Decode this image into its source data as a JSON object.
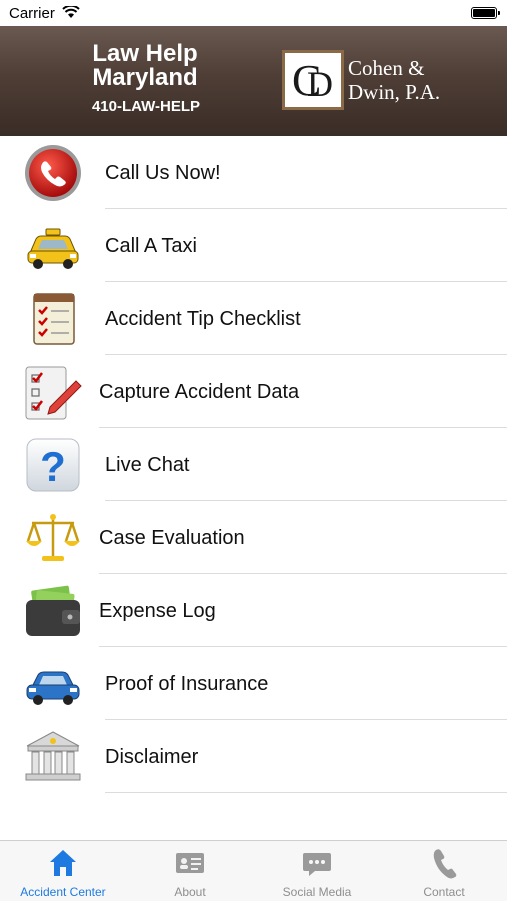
{
  "status_bar": {
    "carrier": "Carrier"
  },
  "header": {
    "title_line1": "Law Help",
    "title_line2": "Maryland",
    "phone": "410-LAW-HELP",
    "logo_letters": "CD",
    "firm_line1": "Cohen &",
    "firm_line2": "Dwin, P.A."
  },
  "menu": [
    {
      "label": "Call Us Now!",
      "icon": "phone-icon"
    },
    {
      "label": "Call A Taxi",
      "icon": "taxi-icon"
    },
    {
      "label": "Accident Tip Checklist",
      "icon": "checklist-icon"
    },
    {
      "label": "Capture Accident Data",
      "icon": "clipboard-pencil-icon"
    },
    {
      "label": "Live Chat",
      "icon": "question-icon"
    },
    {
      "label": "Case Evaluation",
      "icon": "scales-icon"
    },
    {
      "label": "Expense Log",
      "icon": "wallet-icon"
    },
    {
      "label": "Proof of Insurance",
      "icon": "car-icon"
    },
    {
      "label": "Disclaimer",
      "icon": "courthouse-icon"
    }
  ],
  "tabs": [
    {
      "label": "Accident Center",
      "icon": "home-icon",
      "active": true
    },
    {
      "label": "About",
      "icon": "id-card-icon",
      "active": false
    },
    {
      "label": "Social Media",
      "icon": "chat-bubble-icon",
      "active": false
    },
    {
      "label": "Contact",
      "icon": "phone-handset-icon",
      "active": false
    }
  ],
  "colors": {
    "header_bg": "#4e3e36",
    "tab_active": "#1e7ae0",
    "tab_inactive": "#8e8e8e",
    "logo_border": "#8b6a48"
  }
}
